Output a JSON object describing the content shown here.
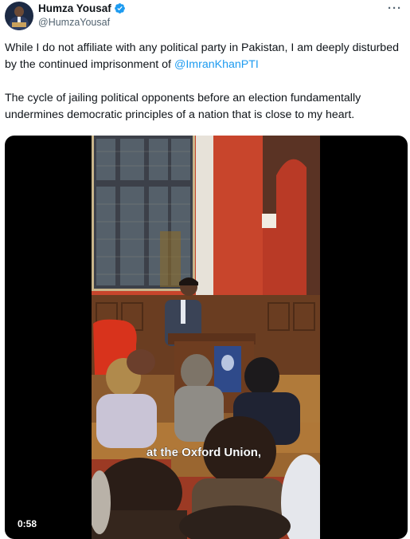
{
  "author": {
    "display_name": "Humza Yousaf",
    "handle": "@HumzaYousaf",
    "verified_color": "#1d9bf0"
  },
  "header": {
    "more_label": "···"
  },
  "tweet": {
    "para1_text": "While I do not affiliate with any political party in Pakistan, I am deeply disturbed by the continued imprisonment of ",
    "para1_mention": "@ImranKhanPTI",
    "para2_text": "The cycle of jailing political opponents before an election fundamentally undermines democratic principles of a nation that is close to my heart.",
    "mention_color": "#1d9bf0"
  },
  "video": {
    "caption": "at the Oxford Union,",
    "duration": "0:58"
  }
}
